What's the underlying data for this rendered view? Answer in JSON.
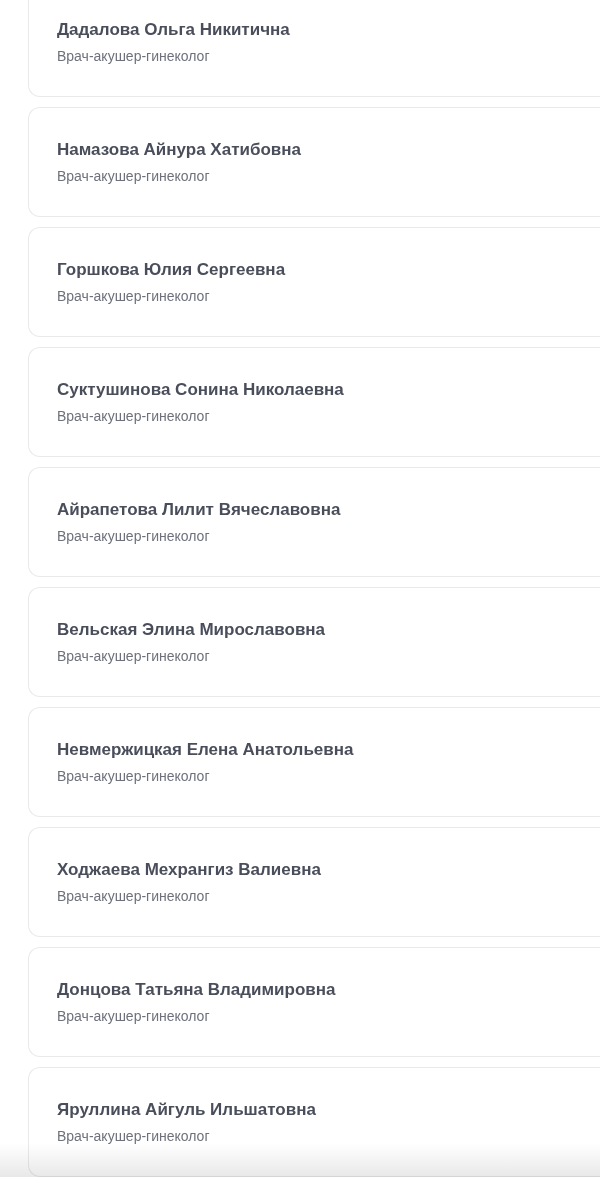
{
  "doctors": [
    {
      "name": "Дадалова Ольга Никитична",
      "specialty": "Врач-акушер-гинеколог"
    },
    {
      "name": "Намазова Айнура Хатибовна",
      "specialty": "Врач-акушер-гинеколог"
    },
    {
      "name": "Горшкова Юлия Сергеевна",
      "specialty": "Врач-акушер-гинеколог"
    },
    {
      "name": "Суктушинова Сонина Николаевна",
      "specialty": "Врач-акушер-гинеколог"
    },
    {
      "name": "Айрапетова Лилит Вячеславовна",
      "specialty": "Врач-акушер-гинеколог"
    },
    {
      "name": "Вельская Элина Мирославовна",
      "specialty": "Врач-акушер-гинеколог"
    },
    {
      "name": "Невмержицкая Елена Анатольевна",
      "specialty": "Врач-акушер-гинеколог"
    },
    {
      "name": "Ходжаева Мехрангиз Валиевна",
      "specialty": "Врач-акушер-гинеколог"
    },
    {
      "name": "Донцова Татьяна Владимировна",
      "specialty": "Врач-акушер-гинеколог"
    },
    {
      "name": "Яруллина Айгуль Ильшатовна",
      "specialty": "Врач-акушер-гинеколог"
    }
  ]
}
